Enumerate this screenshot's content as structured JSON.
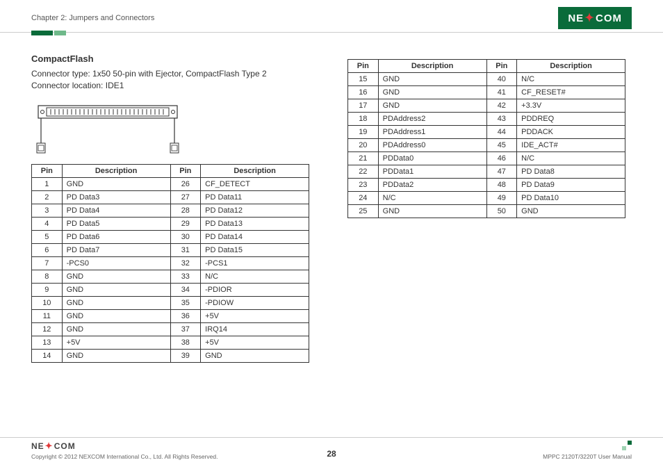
{
  "header": {
    "chapter": "Chapter 2: Jumpers and Connectors",
    "logo": "NEXCOM"
  },
  "section": {
    "title": "CompactFlash",
    "line1": "Connector type: 1x50 50-pin with Ejector, CompactFlash Type 2",
    "line2": "Connector location: IDE1"
  },
  "table_headers": {
    "pin": "Pin",
    "desc": "Description"
  },
  "pins_left": [
    {
      "p1": "1",
      "d1": "GND",
      "p2": "26",
      "d2": "CF_DETECT"
    },
    {
      "p1": "2",
      "d1": "PD Data3",
      "p2": "27",
      "d2": "PD Data11"
    },
    {
      "p1": "3",
      "d1": "PD Data4",
      "p2": "28",
      "d2": "PD Data12"
    },
    {
      "p1": "4",
      "d1": "PD Data5",
      "p2": "29",
      "d2": "PD Data13"
    },
    {
      "p1": "5",
      "d1": "PD Data6",
      "p2": "30",
      "d2": "PD Data14"
    },
    {
      "p1": "6",
      "d1": "PD Data7",
      "p2": "31",
      "d2": "PD Data15"
    },
    {
      "p1": "7",
      "d1": "-PCS0",
      "p2": "32",
      "d2": "-PCS1"
    },
    {
      "p1": "8",
      "d1": "GND",
      "p2": "33",
      "d2": "N/C"
    },
    {
      "p1": "9",
      "d1": "GND",
      "p2": "34",
      "d2": "-PDIOR"
    },
    {
      "p1": "10",
      "d1": "GND",
      "p2": "35",
      "d2": "-PDIOW"
    },
    {
      "p1": "11",
      "d1": "GND",
      "p2": "36",
      "d2": "+5V"
    },
    {
      "p1": "12",
      "d1": "GND",
      "p2": "37",
      "d2": "IRQ14"
    },
    {
      "p1": "13",
      "d1": "+5V",
      "p2": "38",
      "d2": "+5V"
    },
    {
      "p1": "14",
      "d1": "GND",
      "p2": "39",
      "d2": "GND"
    }
  ],
  "pins_right": [
    {
      "p1": "15",
      "d1": "GND",
      "p2": "40",
      "d2": "N/C"
    },
    {
      "p1": "16",
      "d1": "GND",
      "p2": "41",
      "d2": "CF_RESET#"
    },
    {
      "p1": "17",
      "d1": "GND",
      "p2": "42",
      "d2": "+3.3V"
    },
    {
      "p1": "18",
      "d1": "PDAddress2",
      "p2": "43",
      "d2": "PDDREQ"
    },
    {
      "p1": "19",
      "d1": "PDAddress1",
      "p2": "44",
      "d2": "PDDACK"
    },
    {
      "p1": "20",
      "d1": "PDAddress0",
      "p2": "45",
      "d2": "IDE_ACT#"
    },
    {
      "p1": "21",
      "d1": "PDData0",
      "p2": "46",
      "d2": "N/C"
    },
    {
      "p1": "22",
      "d1": "PDData1",
      "p2": "47",
      "d2": "PD Data8"
    },
    {
      "p1": "23",
      "d1": "PDData2",
      "p2": "48",
      "d2": "PD Data9"
    },
    {
      "p1": "24",
      "d1": "N/C",
      "p2": "49",
      "d2": "PD Data10"
    },
    {
      "p1": "25",
      "d1": "GND",
      "p2": "50",
      "d2": "GND"
    }
  ],
  "footer": {
    "logo": "NEXCOM",
    "copyright": "Copyright © 2012 NEXCOM International Co., Ltd. All Rights Reserved.",
    "page": "28",
    "manual": "MPPC 2120T/3220T User Manual"
  }
}
